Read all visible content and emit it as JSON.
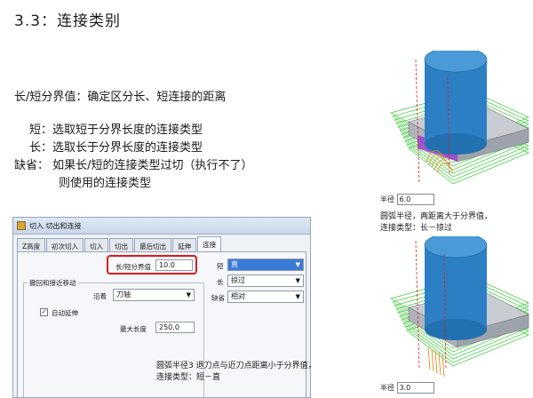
{
  "title": "3.3：连接类别",
  "heading": "长/短分界值：确定区分长、短连接的距离",
  "bullets": {
    "short": "短：选取短于分界长度的连接类型",
    "long": "长：选取长于分界长度的连接类型",
    "default_line1": "缺省：  如果长/短的连接类型过切（执行不了）",
    "default_line2": "则使用的连接类型"
  },
  "dialog": {
    "title": "切入 切出和连接",
    "tabs": [
      "Z高度",
      "初次切入",
      "切入",
      "切出",
      "最后切出",
      "延伸",
      "连接"
    ],
    "active_tab_index": 6,
    "threshold_label": "长/短分界值",
    "threshold_value": "10.0",
    "short_label": "短",
    "short_value": "直",
    "long_label": "长",
    "long_value": "掠过",
    "default_label": "缺省",
    "default_value": "相对",
    "group_title": "撤回和接近移动",
    "along_label": "沿着",
    "along_value": "刀轴",
    "auto_extend_label": "自动延伸",
    "auto_extend_checked": true,
    "max_length_label": "最大长度",
    "max_length_value": "250.0"
  },
  "top_figure": {
    "radius_label": "半径",
    "radius_value": "6.0",
    "caption_line1": "圆弧半径，两距离大于分界值，",
    "caption_line2": "连接类型：长－掠过"
  },
  "bottom_figure": {
    "radius_label": "半径",
    "radius_value": "3.0",
    "caption_line1": "圆弧半径3  退刀点与近刀点距离小于分界值，",
    "caption_line2": "连接类型：短－直"
  },
  "colors": {
    "accent_red": "#e01818",
    "cylinder_blue": "#2d7fc4",
    "toolpath_green": "#22c822",
    "toolpath_orange": "#e08a20",
    "purple": "#9a3fd0",
    "selection_blue": "#3a7bd5"
  }
}
